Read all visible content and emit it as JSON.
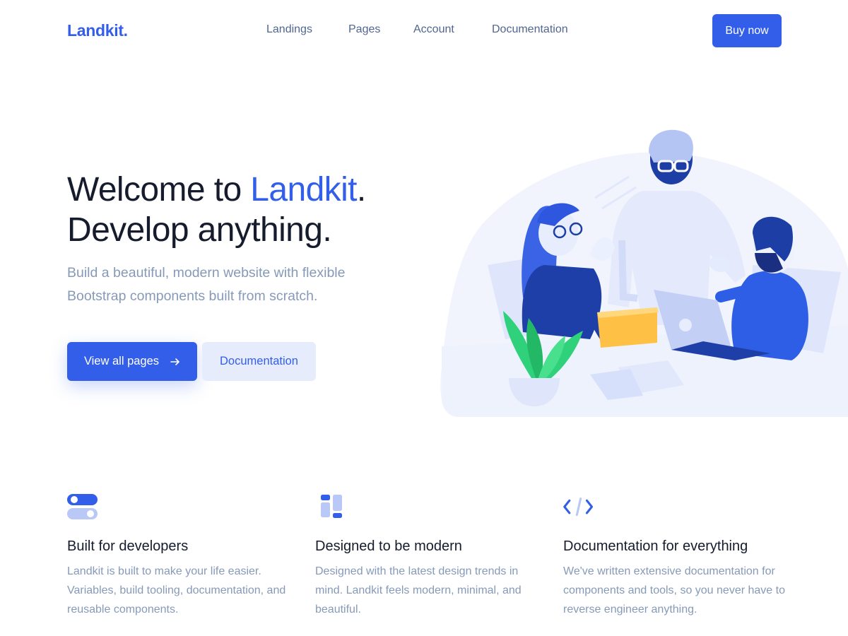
{
  "navbar": {
    "brand": "Landkit.",
    "links": [
      {
        "label": "Landings"
      },
      {
        "label": "Pages"
      },
      {
        "label": "Account"
      },
      {
        "label": "Documentation"
      }
    ],
    "cta": "Buy now"
  },
  "hero": {
    "title_prefix": "Welcome to ",
    "title_accent": "Landkit",
    "title_suffix": ".",
    "title_line2": "Develop anything.",
    "lead": "Build a beautiful, modern website with flexible Bootstrap components built from scratch.",
    "primary_button": "View all pages",
    "primary_button_icon": "arrow-right-icon",
    "secondary_button": "Documentation"
  },
  "features": [
    {
      "icon": "toggles-icon",
      "title": "Built for developers",
      "text": "Landkit is built to make your life easier. Variables, build tooling, documentation, and reusable components."
    },
    {
      "icon": "layout-blocks-icon",
      "title": "Designed to be modern",
      "text": "Designed with the latest design trends in mind. Landkit feels modern, minimal, and beautiful."
    },
    {
      "icon": "code-brackets-icon",
      "title": "Documentation for everything",
      "text": "We've written extensive documentation for components and tools, so you never have to reverse engineer anything."
    }
  ],
  "colors": {
    "primary": "#335eea",
    "heading": "#161c2d",
    "muted": "#869ab8",
    "nav": "#506690",
    "soft": "#e6ecfb"
  }
}
